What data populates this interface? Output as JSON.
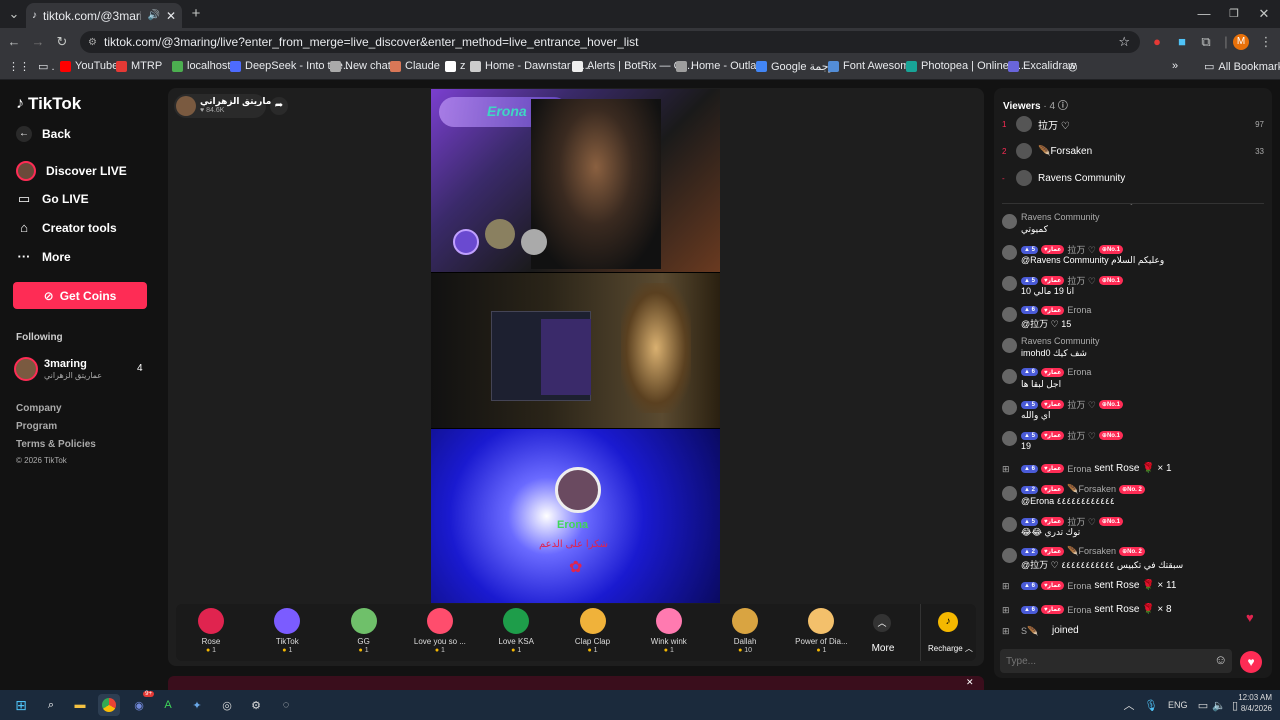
{
  "browser": {
    "tab_title": "tiktok.com/@3maring/live?",
    "url": "tiktok.com/@3maring/live?enter_from_merge=live_discover&enter_method=live_entrance_hover_list",
    "profile_initial": "M",
    "bookmarks": [
      {
        "label": "YouTube",
        "color": "#ff0000"
      },
      {
        "label": "MTRP",
        "color": "#e53935"
      },
      {
        "label": "localhost",
        "color": "#4caf50"
      },
      {
        "label": "DeepSeek - Into the...",
        "color": "#4d6bfe"
      },
      {
        "label": "New chat",
        "color": "#aaaaaa"
      },
      {
        "label": "Claude",
        "color": "#d97757"
      },
      {
        "label": "z",
        "color": "#ffffff"
      },
      {
        "label": "Home - Dawnstar D...",
        "color": "#cccccc"
      },
      {
        "label": "Alerts | BotRix — Cl...",
        "color": "#eeeeee"
      },
      {
        "label": "Home - Outlaw",
        "color": "#9e9e9e"
      },
      {
        "label": "Google ترجمة",
        "color": "#4285f4"
      },
      {
        "label": "Font Awesome",
        "color": "#538dd7"
      },
      {
        "label": "Photopea | Online P...",
        "color": "#18a497"
      },
      {
        "label": "Excalidraw",
        "color": "#6965db"
      }
    ],
    "all_bookmarks": "All Bookmarks"
  },
  "sidebar": {
    "logo": "TikTok",
    "back": "Back",
    "nav": [
      {
        "label": "Discover LIVE"
      },
      {
        "label": "Go LIVE"
      },
      {
        "label": "Creator tools"
      },
      {
        "label": "More"
      }
    ],
    "get_coins": "Get Coins",
    "following_header": "Following",
    "following": {
      "name": "3maring",
      "sub": "عماريتق الزهراني",
      "count": "4"
    },
    "footer": [
      "Company",
      "Program",
      "Terms & Policies",
      "© 2026 TikTok"
    ]
  },
  "stream": {
    "host_name": "عماريتق الزهراني",
    "likes": "84.6K",
    "overlay_name": "Erona",
    "overlay_text": "شكرا على الدعم"
  },
  "gifts": [
    {
      "name": "Rose",
      "price": "1",
      "color": "#e0244f"
    },
    {
      "name": "TikTok",
      "price": "1",
      "color": "#7b5cff"
    },
    {
      "name": "GG",
      "price": "1",
      "color": "#6fc06a"
    },
    {
      "name": "Love you so ...",
      "price": "1",
      "color": "#ff4d6d"
    },
    {
      "name": "Love KSA",
      "price": "1",
      "color": "#1e9d4a"
    },
    {
      "name": "Clap Clap",
      "price": "1",
      "color": "#f0b23a"
    },
    {
      "name": "Wink wink",
      "price": "1",
      "color": "#ff7ab0"
    },
    {
      "name": "Dallah",
      "price": "10",
      "color": "#d9a441"
    },
    {
      "name": "Power of Dia...",
      "price": "1",
      "color": "#f3c06b"
    }
  ],
  "gift_more": "More",
  "recharge": "Recharge",
  "viewers": {
    "title": "Viewers",
    "count": "· 4",
    "list": [
      {
        "rank": "1",
        "name": "拉万 ♡",
        "score": "97"
      },
      {
        "rank": "2",
        "name": "🪶Forsaken",
        "score": "33"
      },
      {
        "rank": "-",
        "name": "Ravens Community",
        "score": ""
      }
    ]
  },
  "chat": [
    {
      "user": "Ravens Community",
      "text": "كميوتي",
      "lvl": "",
      "fan": "",
      "no": ""
    },
    {
      "user": "拉万 ♡",
      "text": "@Ravens Community وعليكم السلام",
      "lvl": "5",
      "fan": "عمار",
      "no": "No.1"
    },
    {
      "user": "拉万 ♡",
      "text": "10 انا 19 مالي",
      "lvl": "5",
      "fan": "عمار",
      "no": "No.1"
    },
    {
      "user": "Erona",
      "text": "@拉万 ♡ 15",
      "lvl": "6",
      "fan": "عمار",
      "no": ""
    },
    {
      "user": "Ravens Community",
      "text": "imohd0 شف كيك",
      "lvl": "",
      "fan": "",
      "no": ""
    },
    {
      "user": "Erona",
      "text": "اجل لبقا ها",
      "lvl": "6",
      "fan": "عمار",
      "no": ""
    },
    {
      "user": "拉万 ♡",
      "text": "اي والله",
      "lvl": "5",
      "fan": "عمار",
      "no": "No.1"
    },
    {
      "user": "拉万 ♡",
      "text": "19",
      "lvl": "5",
      "fan": "عمار",
      "no": "No.1"
    },
    {
      "user": "Erona",
      "text": "sent Rose 🌹 × 1",
      "lvl": "6",
      "fan": "عمار",
      "no": "",
      "gift": true
    },
    {
      "user": "🪶Forsaken",
      "text": "@Erona ٤٤٤٤٤٤٤٤٤٤٤٤",
      "lvl": "2",
      "fan": "عمار",
      "no": "No. 2"
    },
    {
      "user": "拉万 ♡",
      "text": "😂😂 توك تدري",
      "lvl": "5",
      "fan": "عمار",
      "no": "No.1"
    },
    {
      "user": "🪶Forsaken",
      "text": "@拉万 ♡ سبقتك في تكبيس ٤٤٤٤٤٤٤٤٤٤٤",
      "lvl": "2",
      "fan": "عمار",
      "no": "No. 2"
    },
    {
      "user": "Erona",
      "text": "sent Rose 🌹 × 11",
      "lvl": "6",
      "fan": "عمار",
      "no": "",
      "gift": true
    },
    {
      "user": "Erona",
      "text": "sent Rose 🌹 × 8",
      "lvl": "6",
      "fan": "عمار",
      "no": "",
      "gift": true
    }
  ],
  "joined": {
    "user": "S🪶",
    "text": "joined"
  },
  "input_placeholder": "Type...",
  "taskbar": {
    "lang": "ENG",
    "time": "12:03 AM",
    "date": "8/4/2026",
    "chat_badge": "9+"
  }
}
